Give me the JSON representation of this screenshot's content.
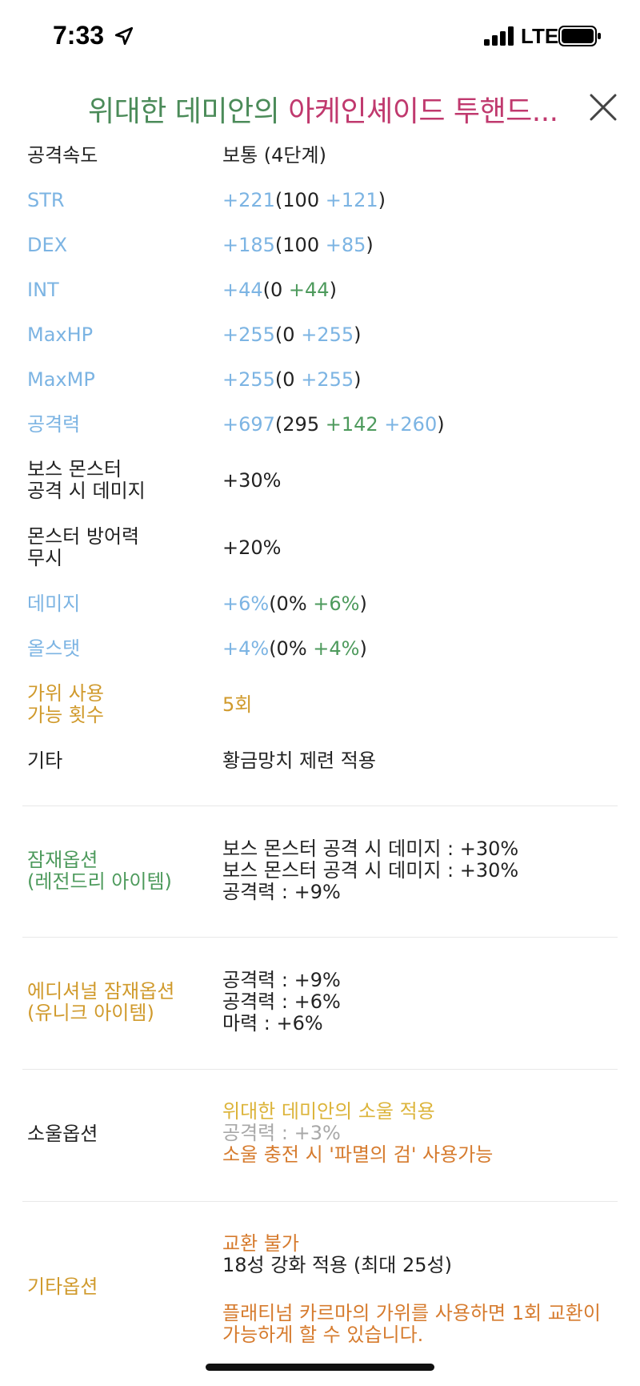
{
  "status_bar": {
    "time": "7:33",
    "network": "LTE",
    "icons": [
      "location-arrow-icon",
      "signal-bars-icon",
      "battery-icon"
    ]
  },
  "header": {
    "title_part1": "위대한 데미안의 ",
    "title_part2": "아케인셰이드 투핸드...",
    "close_icon": "close-icon"
  },
  "stats": {
    "attack_speed": {
      "label": "공격속도",
      "value": "보통 (4단계)"
    },
    "str": {
      "label": "STR",
      "total": "+221",
      "open": "(100 ",
      "a": "+121",
      "close": ")"
    },
    "dex": {
      "label": "DEX",
      "total": "+185",
      "open": "(100 ",
      "a": "+85",
      "close": ")"
    },
    "int": {
      "label": "INT",
      "total": "+44",
      "open": "(0 ",
      "a": "+44",
      "close": ")"
    },
    "maxhp": {
      "label": "MaxHP",
      "total": "+255",
      "open": "(0 ",
      "a": "+255",
      "close": ")"
    },
    "maxmp": {
      "label": "MaxMP",
      "total": "+255",
      "open": "(0 ",
      "a": "+255",
      "close": ")"
    },
    "attack": {
      "label": "공격력",
      "total": "+697",
      "open": "(295 ",
      "a": "+142",
      "b": "+260",
      "close": ")"
    },
    "boss_damage": {
      "label_line1": "보스 몬스터",
      "label_line2": "공격 시 데미지",
      "value": "+30%"
    },
    "ignore_def": {
      "label_line1": "몬스터 방어력",
      "label_line2": "무시",
      "value": "+20%"
    },
    "damage": {
      "label": "데미지",
      "total": "+6%",
      "open": "(0% ",
      "a": "+6%",
      "close": ")"
    },
    "all_stat": {
      "label": "올스탯",
      "total": "+4%",
      "open": "(0% ",
      "a": "+4%",
      "close": ")"
    },
    "scissors": {
      "label_line1": "가위 사용",
      "label_line2": "가능 횟수",
      "value": "5회"
    },
    "etc": {
      "label": "기타",
      "value": "황금망치 제련 적용"
    }
  },
  "potential": {
    "label_line1": "잠재옵션",
    "label_line2": "(레전드리 아이템)",
    "lines": [
      "보스 몬스터 공격 시 데미지 : +30%",
      "보스 몬스터 공격 시 데미지 : +30%",
      "공격력 : +9%"
    ]
  },
  "additional_potential": {
    "label_line1": "에디셔널 잠재옵션",
    "label_line2": "(유니크 아이템)",
    "lines": [
      "공격력 : +9%",
      "공격력 : +6%",
      "마력 : +6%"
    ]
  },
  "soul": {
    "label": "소울옵션",
    "line1": "위대한 데미안의 소울 적용",
    "line2": "공격력 : +3%",
    "line3": "소울 충전 시 '파멸의 검' 사용가능"
  },
  "other_options": {
    "label": "기타옵션",
    "line1": "교환 불가",
    "line2": "18성 강화 적용 (최대 25성)",
    "line3": "플래티넘 카르마의 가위를 사용하면 1회 교환이",
    "line4": "가능하게 할 수 있습니다."
  },
  "colors": {
    "stat_blue": "#7cb4e3",
    "stat_green": "#4d9a5c",
    "title_green": "#4b8b59",
    "title_magenta": "#c0396e",
    "gold": "#d09a2c",
    "orange": "#d67b2e"
  }
}
